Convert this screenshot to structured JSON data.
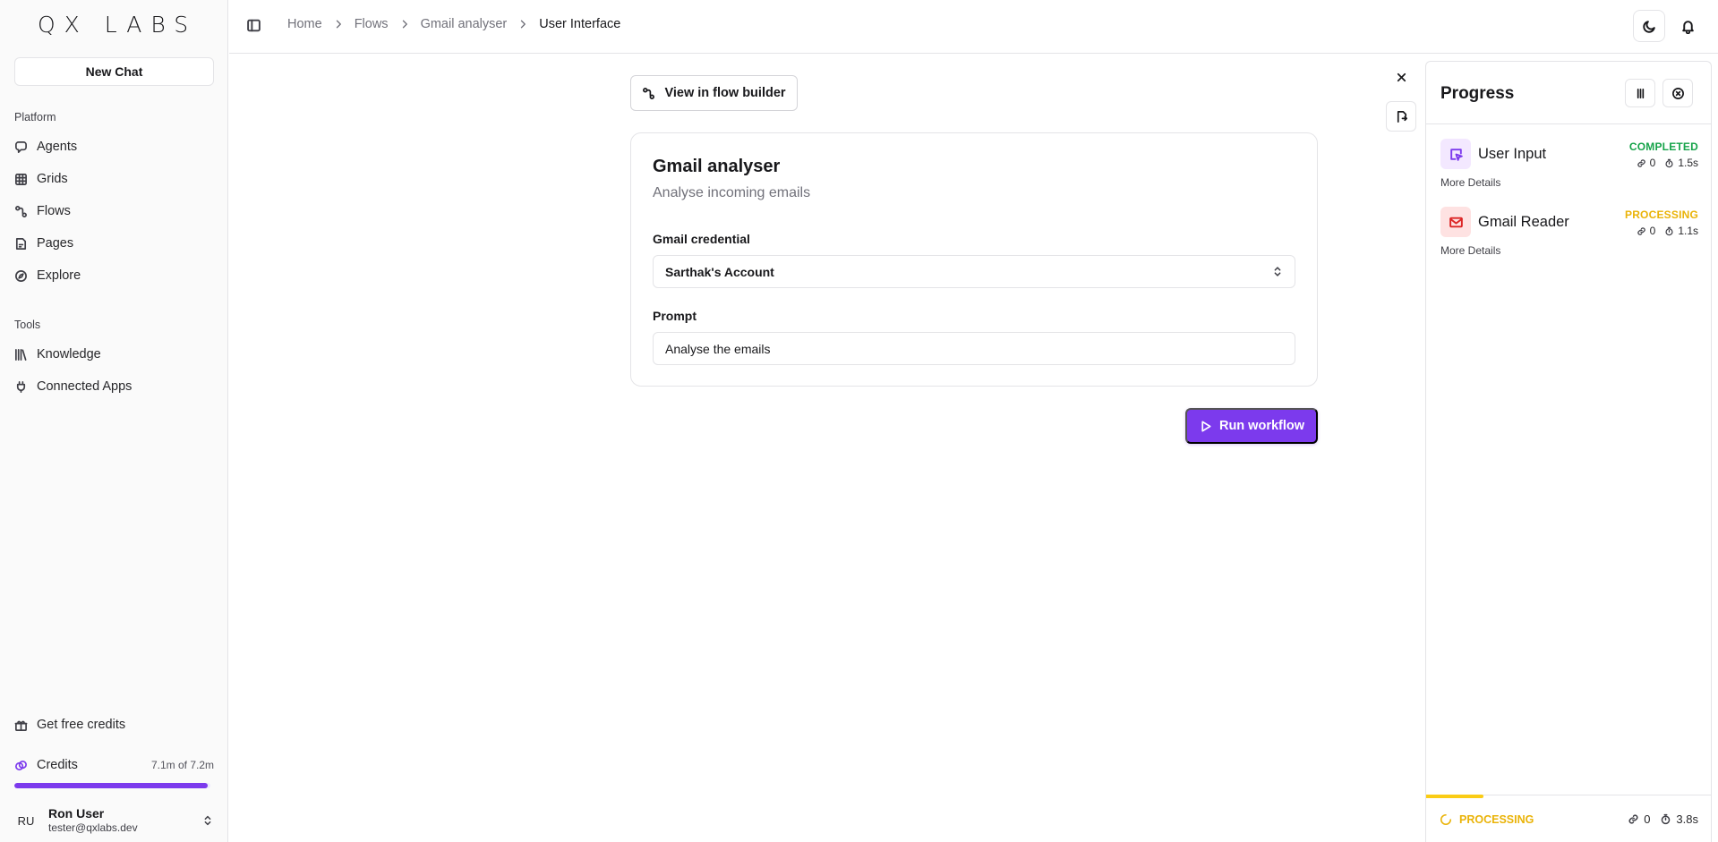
{
  "brand": {
    "logo_text": "QX LABS"
  },
  "sidebar": {
    "new_chat_label": "New Chat",
    "platform_label": "Platform",
    "platform_items": [
      {
        "label": "Agents",
        "icon": "agents-icon"
      },
      {
        "label": "Grids",
        "icon": "grid-icon"
      },
      {
        "label": "Flows",
        "icon": "flows-icon"
      },
      {
        "label": "Pages",
        "icon": "pages-icon"
      },
      {
        "label": "Explore",
        "icon": "compass-icon"
      }
    ],
    "tools_label": "Tools",
    "tools_items": [
      {
        "label": "Knowledge",
        "icon": "library-icon"
      },
      {
        "label": "Connected Apps",
        "icon": "plug-icon"
      }
    ],
    "free_credits_label": "Get free credits",
    "credits": {
      "label": "Credits",
      "value": "7.1m of 7.2m",
      "fraction": 0.986
    },
    "user": {
      "initials": "RU",
      "name": "Ron User",
      "email": "tester@qxlabs.dev"
    }
  },
  "header": {
    "breadcrumb": [
      "Home",
      "Flows",
      "Gmail analyser",
      "User Interface"
    ]
  },
  "main": {
    "view_flow_builder_label": "View in flow builder",
    "form": {
      "title": "Gmail analyser",
      "subtitle": "Analyse incoming emails",
      "credential_label": "Gmail credential",
      "credential_value": "Sarthak's Account",
      "prompt_label": "Prompt",
      "prompt_value": "Analyse the emails"
    },
    "run_label": "Run workflow"
  },
  "progress": {
    "title": "Progress",
    "steps": [
      {
        "name": "User Input",
        "status": "COMPLETED",
        "links": "0",
        "time": "1.5s",
        "more": "More Details",
        "status_color": "#16a34a",
        "icon": "user-input-icon"
      },
      {
        "name": "Gmail Reader",
        "status": "PROCESSING",
        "links": "0",
        "time": "1.1s",
        "more": "More Details",
        "status_color": "#eab308",
        "icon": "mail-icon"
      }
    ],
    "footer": {
      "status": "PROCESSING",
      "links": "0",
      "time": "3.8s",
      "fraction": 0.2
    }
  },
  "colors": {
    "accent": "#7c3aed",
    "completed": "#16a34a",
    "processing": "#eab308"
  }
}
